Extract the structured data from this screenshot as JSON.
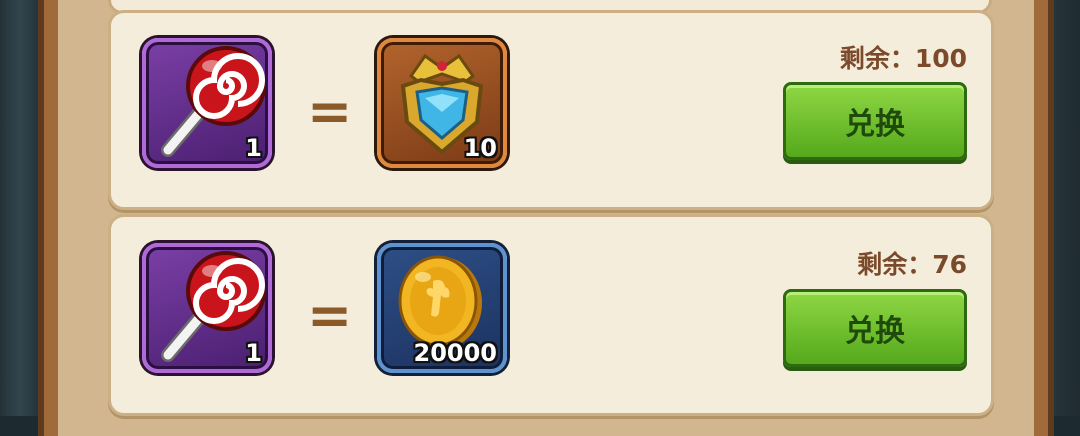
{
  "offers": [
    {
      "cost": {
        "item": "lollipop-icon",
        "count": "1"
      },
      "equals": "=",
      "reward": {
        "item": "crest-emblem-icon",
        "count": "10"
      },
      "remaining": "剩余：100",
      "button": "兑换"
    },
    {
      "cost": {
        "item": "lollipop-icon",
        "count": "1"
      },
      "equals": "=",
      "reward": {
        "item": "gold-coin-icon",
        "count": "20000"
      },
      "remaining": "剩余：76",
      "button": "兑换"
    }
  ],
  "colors": {
    "panel": "#f5eddc",
    "button": "#6cbf2a",
    "text": "#7a4a2a"
  }
}
